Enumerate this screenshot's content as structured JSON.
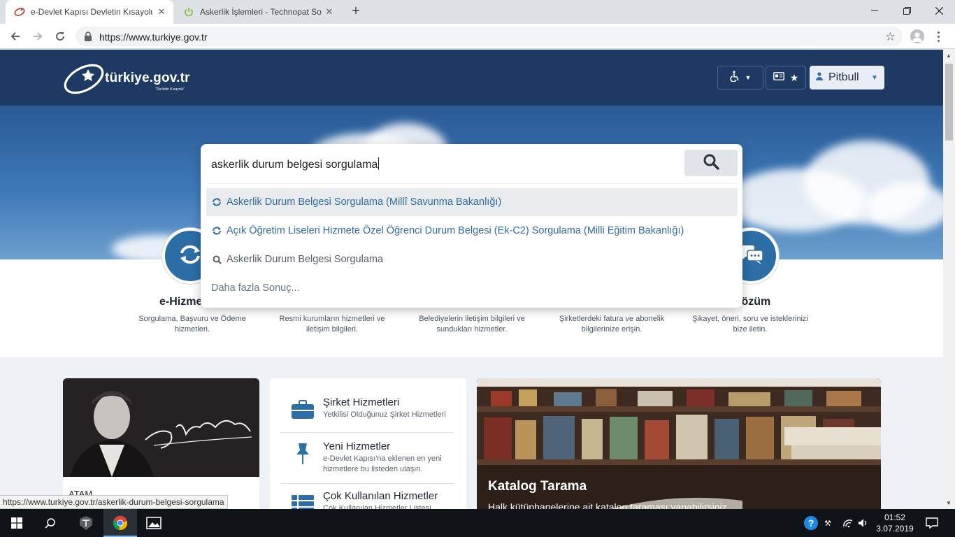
{
  "browser": {
    "tabs": [
      {
        "title": "e-Devlet Kapısı Devletin Kısayolu",
        "active": true
      },
      {
        "title": "Askerlik İşlemleri - Technopat Sos",
        "active": false
      }
    ],
    "new_tab": "+",
    "url": "https://www.turkiye.gov.tr",
    "status_url": "https://www.turkiye.gov.tr/askerlik-durum-belgesi-sorgulama"
  },
  "header": {
    "logo_text": "türkiye.gov.tr",
    "logo_sub": "\"Devletin Kısayolu\"",
    "user_name": "Pitbull"
  },
  "search": {
    "query": "askerlik durum belgesi sorgulama",
    "suggestions": [
      {
        "text": "Askerlik Durum Belgesi Sorgulama (Millî Savunma Bakanlığı)",
        "type": "service",
        "highlighted": true
      },
      {
        "text": "Açık Öğretim Liseleri Hizmete Özel Öğrenci Durum Belgesi (Ek-C2) Sorgulama (Milli Eğitim Bakanlığı)",
        "type": "service",
        "highlighted": false
      },
      {
        "text": "Askerlik Durum Belgesi Sorgulama",
        "type": "search",
        "highlighted": false
      }
    ],
    "more": "Daha fazla Sonuç..."
  },
  "features": [
    {
      "title": "e-Hizme",
      "desc": "Sorgulama, Başvuru ve Ödeme hizmetleri."
    },
    {
      "title": "",
      "desc": "Resmi kurumların hizmetleri ve iletişim bilgileri."
    },
    {
      "title": "",
      "desc": "Belediyelerin iletişim bilgileri ve sundukları hizmetler."
    },
    {
      "title": "",
      "desc": "Şirketlerdeki fatura ve abonelik bilgilerinize erişin."
    },
    {
      "title": "i Çözüm",
      "desc": "Şikayet, öneri, soru ve isteklerinizi bize iletin."
    }
  ],
  "ataturk_caption": "ATAM",
  "services": [
    {
      "title": "Şirket Hizmetleri",
      "desc": "Yetkilisi Olduğunuz Şirket Hizmetleri",
      "icon": "briefcase-icon"
    },
    {
      "title": "Yeni Hizmetler",
      "desc": "e-Devlet Kapısı'na eklenen en yeni hizmetlere bu listeden ulaşın.",
      "icon": "pin-icon"
    },
    {
      "title": "Çok Kullanılan Hizmetler",
      "desc": "Çok Kullanılan Hizmetler Listesi",
      "icon": "list-icon"
    }
  ],
  "katalog": {
    "title": "Katalog Tarama",
    "desc": "Halk kütüphanelerine ait katalog taraması yapabilirsiniz."
  },
  "taskbar": {
    "time": "01:52",
    "date": "3.07.2019"
  },
  "colors": {
    "brand_dark": "#1e3a62",
    "link": "#2f6aa6",
    "feature_circle": "#2c6ea5"
  }
}
